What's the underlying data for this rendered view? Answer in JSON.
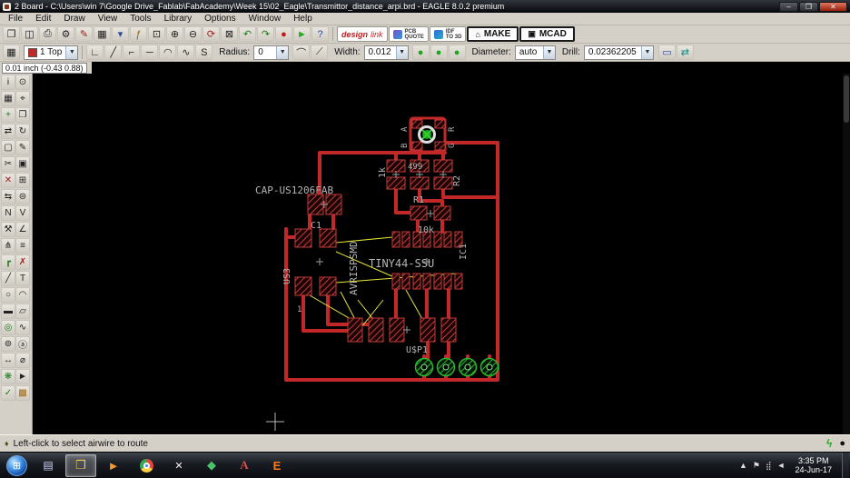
{
  "titlebar": {
    "title": "2 Board - C:\\Users\\win 7\\Google Drive_Fablab\\FabAcademy\\Week 15\\02_Eagle\\Transmittor_distance_arpi.brd - EAGLE 8.0.2 premium",
    "minimize": "–",
    "maximize": "❐",
    "close": "✕"
  },
  "menubar": {
    "items": [
      {
        "label": "File",
        "name": "menu-file"
      },
      {
        "label": "Edit",
        "name": "menu-edit"
      },
      {
        "label": "Draw",
        "name": "menu-draw"
      },
      {
        "label": "View",
        "name": "menu-view"
      },
      {
        "label": "Tools",
        "name": "menu-tools"
      },
      {
        "label": "Library",
        "name": "menu-library"
      },
      {
        "label": "Options",
        "name": "menu-options"
      },
      {
        "label": "Window",
        "name": "menu-window"
      },
      {
        "label": "Help",
        "name": "menu-help"
      }
    ]
  },
  "toolbar_main": {
    "icons": [
      {
        "name": "open-icon",
        "glyph": "❐"
      },
      {
        "name": "save-icon",
        "glyph": "◫"
      },
      {
        "name": "print-icon",
        "glyph": "⎙"
      },
      {
        "name": "cam-icon",
        "glyph": "⚙"
      },
      {
        "name": "script-icon",
        "glyph": "✎",
        "color": "#a02020"
      },
      {
        "name": "sheet-icon",
        "glyph": "▦"
      },
      {
        "name": "layer-settings-icon",
        "glyph": "▾",
        "color": "#2a4a9a"
      },
      {
        "name": "ulp-icon",
        "glyph": "ƒ",
        "color": "#8a6a10"
      },
      {
        "name": "zoom-fit-icon",
        "glyph": "⊡"
      },
      {
        "name": "zoom-in-icon",
        "glyph": "⊕"
      },
      {
        "name": "zoom-out-icon",
        "glyph": "⊖"
      },
      {
        "name": "zoom-redraw-icon",
        "glyph": "⟳",
        "color": "#a02020"
      },
      {
        "name": "zoom-select-icon",
        "glyph": "⊠"
      },
      {
        "name": "undo-icon",
        "glyph": "↶",
        "color": "#1f7a1f"
      },
      {
        "name": "redo-icon",
        "glyph": "↷",
        "color": "#1f7a1f"
      },
      {
        "name": "stop-icon",
        "glyph": "●",
        "color": "#c01818"
      },
      {
        "name": "go-icon",
        "glyph": "►",
        "color": "#1fae1f"
      },
      {
        "name": "help-icon",
        "glyph": "?",
        "color": "#2a4a9a"
      }
    ],
    "design_word": "design",
    "link_word": "link",
    "pcb": "PCB",
    "quote": "QUOTE",
    "idf": "IDF",
    "to3d": "TO 3D",
    "make": "MAKE",
    "make_icon": "⌂",
    "mcad": "MCAD",
    "mcad_icon": "▣"
  },
  "toolbar_params": {
    "layer": "1 Top",
    "bends": [
      {
        "name": "bend-90-icon",
        "glyph": "∟"
      },
      {
        "name": "bend-45-icon",
        "glyph": "╱"
      },
      {
        "name": "bend-corner-icon",
        "glyph": "⌐"
      },
      {
        "name": "bend-straight-icon",
        "glyph": "─"
      },
      {
        "name": "bend-arc-icon",
        "glyph": "◠"
      },
      {
        "name": "bend-free-icon",
        "glyph": "∿"
      },
      {
        "name": "bend-s-icon",
        "glyph": "S"
      }
    ],
    "radius_label": "Radius:",
    "radius": "0",
    "miters": [
      {
        "name": "miter-round-icon",
        "glyph": "⌒"
      },
      {
        "name": "miter-straight-icon",
        "glyph": "⟋"
      }
    ],
    "width_label": "Width:",
    "width": "0.012",
    "vias": [
      {
        "name": "via-round-icon",
        "glyph": "●"
      },
      {
        "name": "via-square-icon",
        "glyph": "●"
      },
      {
        "name": "via-octagon-icon",
        "glyph": "●"
      }
    ],
    "diameter_label": "Diameter:",
    "diameter": "auto",
    "drill_label": "Drill:",
    "drill": "0.02362205",
    "right_icons": [
      {
        "name": "select-rect-icon",
        "glyph": "▭",
        "color": "#2a4a9a"
      },
      {
        "name": "swap-layer-icon",
        "glyph": "⇄",
        "color": "#0f8a8a"
      }
    ]
  },
  "coordbar": {
    "position": "0.01 inch (-0.43 0.88)",
    "command": ""
  },
  "tools": [
    {
      "name": "info-tool",
      "glyph": "i"
    },
    {
      "name": "show-tool",
      "glyph": "⊙"
    },
    {
      "name": "display-tool",
      "glyph": "▦"
    },
    {
      "name": "mark-tool",
      "glyph": "⌖"
    },
    {
      "name": "move-tool",
      "glyph": "+",
      "color": "#1f7a1f"
    },
    {
      "name": "copy-tool",
      "glyph": "❐"
    },
    {
      "name": "mirror-tool",
      "glyph": "⇄"
    },
    {
      "name": "rotate-tool",
      "glyph": "↻"
    },
    {
      "name": "group-tool",
      "glyph": "▢"
    },
    {
      "name": "change-tool",
      "glyph": "✎"
    },
    {
      "name": "cut-tool",
      "glyph": "✂"
    },
    {
      "name": "paste-tool",
      "glyph": "▣"
    },
    {
      "name": "delete-tool",
      "glyph": "✕",
      "color": "#a02020"
    },
    {
      "name": "add-tool",
      "glyph": "⊞"
    },
    {
      "name": "pinswap-tool",
      "glyph": "⇆"
    },
    {
      "name": "replace-tool",
      "glyph": "⊜"
    },
    {
      "name": "name-tool",
      "glyph": "N"
    },
    {
      "name": "value-tool",
      "glyph": "V"
    },
    {
      "name": "smash-tool",
      "glyph": "⚒"
    },
    {
      "name": "miter-tool",
      "glyph": "∠"
    },
    {
      "name": "split-tool",
      "glyph": "⋔"
    },
    {
      "name": "optimize-tool",
      "glyph": "≡"
    },
    {
      "name": "route-tool",
      "glyph": "┏",
      "color": "#1f7a1f"
    },
    {
      "name": "ripup-tool",
      "glyph": "✗",
      "color": "#a02020"
    },
    {
      "name": "wire-tool",
      "glyph": "╱"
    },
    {
      "name": "text-tool",
      "glyph": "T"
    },
    {
      "name": "circle-tool",
      "glyph": "○"
    },
    {
      "name": "arc-tool",
      "glyph": "◠"
    },
    {
      "name": "rect-tool",
      "glyph": "▬"
    },
    {
      "name": "polygon-tool",
      "glyph": "▱"
    },
    {
      "name": "via-tool",
      "glyph": "◎",
      "color": "#1f7a1f"
    },
    {
      "name": "signal-tool",
      "glyph": "∿"
    },
    {
      "name": "hole-tool",
      "glyph": "⊚"
    },
    {
      "name": "attribute-tool",
      "glyph": "ⓐ"
    },
    {
      "name": "dimension-tool",
      "glyph": "↔"
    },
    {
      "name": "lock-tool",
      "glyph": "⌀"
    },
    {
      "name": "ratsnest-tool",
      "glyph": "❋",
      "color": "#1f7a1f"
    },
    {
      "name": "autoroute-tool",
      "glyph": "►"
    },
    {
      "name": "erc-tool",
      "glyph": "✓",
      "color": "#1f7a1f"
    },
    {
      "name": "drc-tool",
      "glyph": "▩",
      "color": "#a06a10"
    }
  ],
  "pcb": {
    "labels": {
      "cap": "CAP-US1206FAB",
      "c1": "C1",
      "us3": "US3",
      "pin1": "1",
      "avr": "AVRISPSMD",
      "tiny": "TINY44-SSU",
      "ic1": "IC1",
      "r1": "R1",
      "tenk": "10k",
      "onek": "1k",
      "r499": "499",
      "r2": "R2",
      "a": "A",
      "b": "B",
      "r": "R",
      "g": "G",
      "usp1": "U$P1"
    },
    "colors": {
      "copper": "#c22828",
      "airwire": "#e6e63c",
      "via_green": "#27b227",
      "silk": "#b4b4b4"
    }
  },
  "statusbar": {
    "bullet": "♦",
    "hint": "Left-click to select airwire to route",
    "bolt": "ϟ",
    "dot": "●"
  },
  "taskbar": {
    "start_glyph": "⊞",
    "icons": [
      {
        "glyph": "▤"
      },
      {
        "glyph": "❒"
      },
      {
        "glyph": "►"
      },
      {
        "glyph": ""
      },
      {
        "glyph": "✕"
      },
      {
        "glyph": "◆"
      },
      {
        "glyph": "A"
      },
      {
        "glyph": "E"
      }
    ],
    "tray_icons": [
      {
        "name": "show-hidden-icons",
        "glyph": "▲"
      },
      {
        "name": "flag-icon",
        "glyph": "⚑"
      },
      {
        "name": "network-icon",
        "glyph": "⣾"
      },
      {
        "name": "volume-icon",
        "glyph": "◄"
      }
    ],
    "time": "3:35 PM",
    "date": "24-Jun-17"
  }
}
